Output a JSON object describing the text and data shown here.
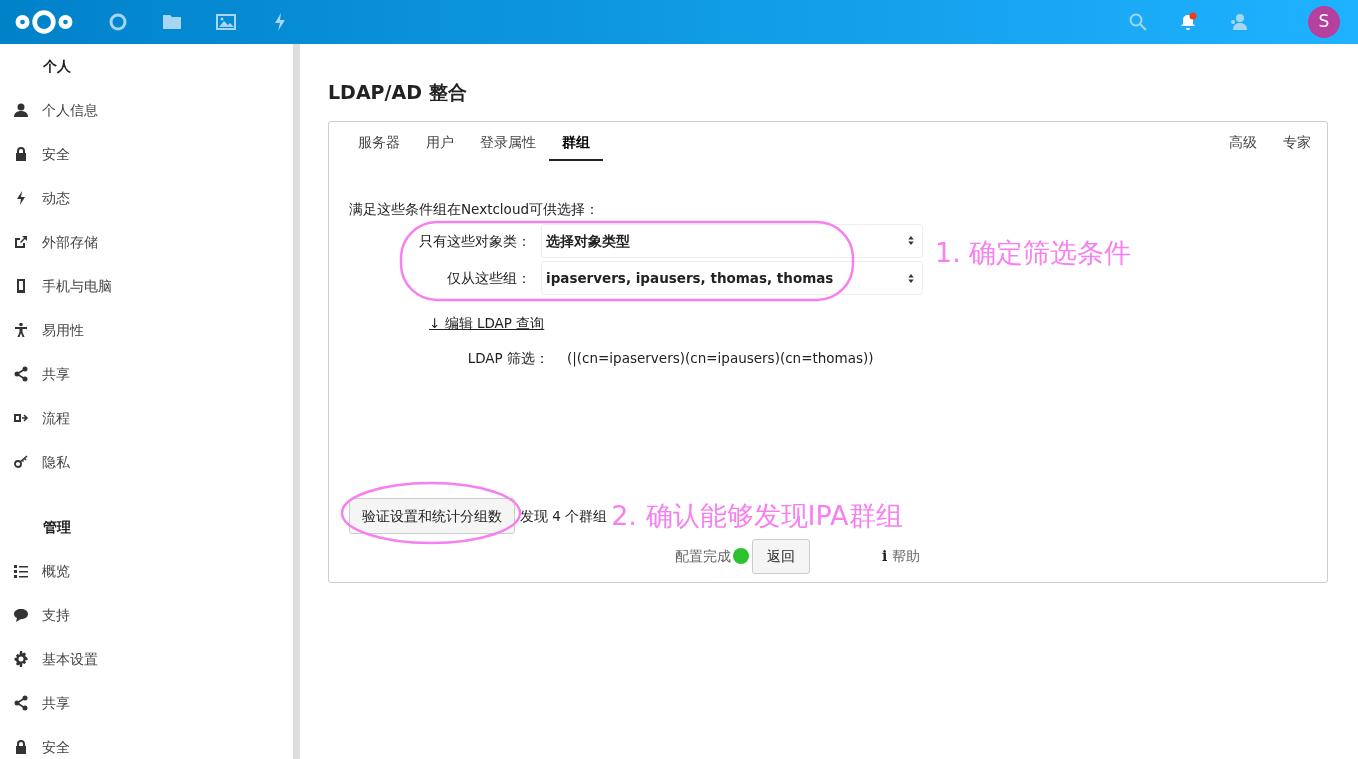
{
  "header": {
    "avatar_letter": "S",
    "notification_unread": true
  },
  "sidebar": {
    "sections": [
      {
        "title": "个人",
        "items": [
          {
            "label": "个人信息"
          },
          {
            "label": "安全"
          },
          {
            "label": "动态"
          },
          {
            "label": "外部存储"
          },
          {
            "label": "手机与电脑"
          },
          {
            "label": "易用性"
          },
          {
            "label": "共享"
          },
          {
            "label": "流程"
          },
          {
            "label": "隐私"
          }
        ]
      },
      {
        "title": "管理",
        "items": [
          {
            "label": "概览"
          },
          {
            "label": "支持"
          },
          {
            "label": "基本设置"
          },
          {
            "label": "共享"
          },
          {
            "label": "安全"
          }
        ]
      }
    ]
  },
  "page_title": "LDAP/AD 整合",
  "tabs": [
    {
      "label": "服务器",
      "selected": false
    },
    {
      "label": "用户",
      "selected": false
    },
    {
      "label": "登录属性",
      "selected": false
    },
    {
      "label": "群组",
      "selected": true
    }
  ],
  "right_tabs": [
    {
      "label": "高级",
      "selected": false
    },
    {
      "label": "专家",
      "selected": false
    }
  ],
  "intro": "满足这些条件组在Nextcloud可供选择：",
  "fields": [
    {
      "label": "只有这些对象类：",
      "value": "选择对象类型"
    },
    {
      "label": "仅从这些组：",
      "value": "ipaservers, ipausers, thomas, thomas"
    }
  ],
  "edit_query_link": "↓ 编辑 LDAP 查询",
  "filter": {
    "label": "LDAP 筛选：",
    "value": "(|(cn=ipaservers)(cn=ipausers)(cn=thomas))"
  },
  "verify_button": "验证设置和统计分组数",
  "found_text": "发现 4 个群组",
  "status": {
    "label": "配置完成",
    "ok": true
  },
  "back_button": "返回",
  "help_link": "帮助",
  "help_icon": "i",
  "annotations": [
    {
      "text": "1. 确定筛选条件"
    },
    {
      "text": "2. 确认能够发现IPA群组"
    }
  ]
}
